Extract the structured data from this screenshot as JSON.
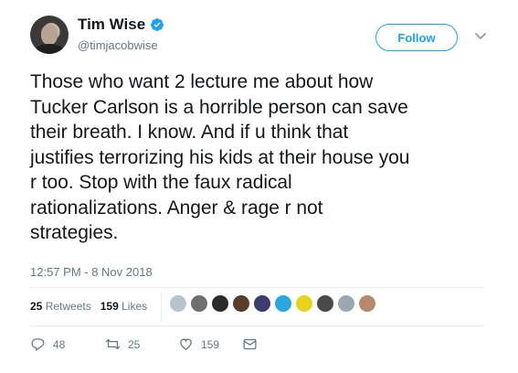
{
  "author": {
    "display_name": "Tim Wise",
    "handle": "@timjacobwise",
    "verified": true,
    "avatar_icon": "profile-photo"
  },
  "header": {
    "follow_label": "Follow",
    "menu_icon": "chevron-down-icon"
  },
  "tweet": {
    "lines": [
      "Those who want 2 lecture me about how",
      "Tucker Carlson is a horrible person can save",
      "their breath. I know. And if u think that",
      "justifies terrorizing his kids at their house you",
      "r too. Stop with the faux radical",
      "rationalizations. Anger & rage r not",
      "strategies."
    ],
    "timestamp": "12:57 PM - 8 Nov 2018"
  },
  "stats": {
    "retweets_count": "25",
    "retweets_label": "Retweets",
    "likes_count": "159",
    "likes_label": "Likes"
  },
  "actions": {
    "reply_count": "48",
    "retweet_count": "25",
    "like_count": "159"
  },
  "colors": {
    "text": "#14171a",
    "secondary": "#657786",
    "brand_blue": "#1da1f2",
    "divider": "#e6ecf0"
  },
  "liker_avatars": [
    {
      "color": "#b9c3cc"
    },
    {
      "color": "#6f6f6f"
    },
    {
      "color": "#2b2b2b"
    },
    {
      "color": "#5a3d2b"
    },
    {
      "color": "#3a3d6e"
    },
    {
      "color": "#2aa7e0"
    },
    {
      "color": "#e8d21a"
    },
    {
      "color": "#4a4a4a"
    },
    {
      "color": "#9aa7b1"
    },
    {
      "color": "#b48a6a"
    }
  ]
}
